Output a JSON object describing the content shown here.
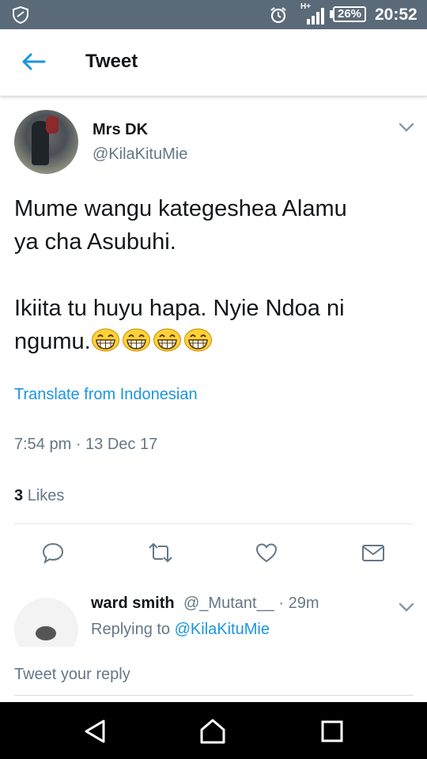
{
  "status_bar": {
    "network": "H+",
    "battery": "26%",
    "time": "20:52",
    "color": "#5b6a79"
  },
  "header": {
    "back_icon": "back-arrow-icon",
    "title": "Tweet"
  },
  "tweet": {
    "author_name": "Mrs DK",
    "author_handle": "@KilaKituMie",
    "text": "Mume wangu kategeshea Alamu\nya cha Asubuhi.\n\nIkiita tu huyu hapa. Nyie Ndoa ni\nngumu.",
    "emoji": [
      "grinning-face-emoji",
      "grinning-face-emoji",
      "grinning-face-emoji",
      "grinning-face-emoji"
    ],
    "translate": "Translate from Indonesian",
    "timestamp": "7:54 pm · 13 Dec 17",
    "likes_count": "3",
    "likes_label": "Likes",
    "actions": [
      "reply-icon",
      "retweet-icon",
      "like-icon",
      "message-icon"
    ]
  },
  "reply": {
    "name": "ward smith",
    "meta": "@_Mutant__ · 29m",
    "replying_prefix": "Replying to",
    "replying_handle": "@KilaKituMie"
  },
  "composer": {
    "placeholder": "Tweet your reply"
  },
  "accent": "#1b95e0"
}
